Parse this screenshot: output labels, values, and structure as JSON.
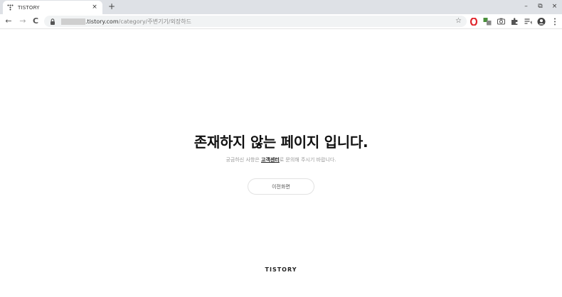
{
  "browser": {
    "tab": {
      "title": "TISTORY",
      "close": "×"
    },
    "new_tab": "+",
    "window_controls": {
      "minimize": "–",
      "restore": "⧉",
      "close": "×"
    },
    "nav": {
      "back": "←",
      "forward": "→",
      "reload": "C"
    },
    "address": {
      "host_suffix": ".tistory.com",
      "path": "/category/주변기기/외장하드"
    },
    "bookmark_star": "☆"
  },
  "page": {
    "headline": "존재하지 않는 페이지 입니다.",
    "desc_before": "궁금하신 사항은 ",
    "desc_link": "고객센터",
    "desc_after": "로 문의해 주시기 바랍니다.",
    "back_button": "이전화면",
    "footer_logo": "TISTORY"
  },
  "colors": {
    "tabstrip_bg": "#dee1e6",
    "omnibox_bg": "#f1f3f4",
    "opera_red": "#e0262d"
  }
}
